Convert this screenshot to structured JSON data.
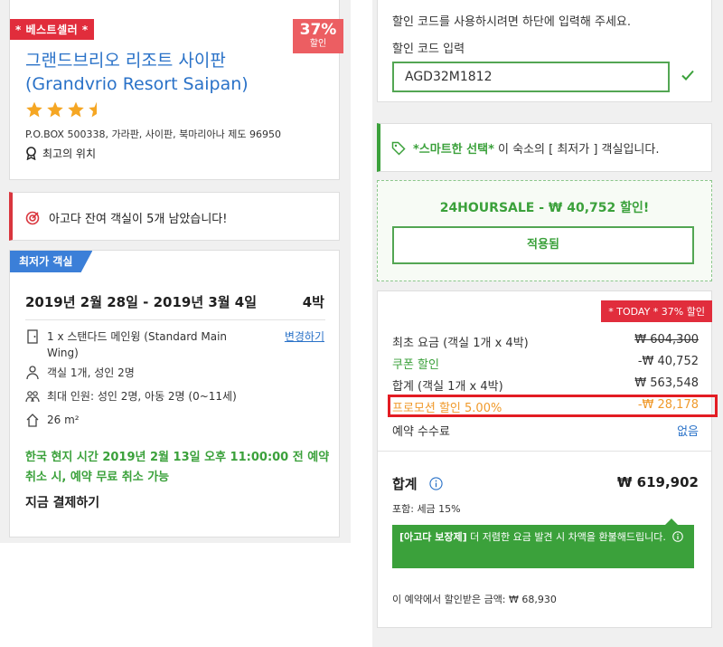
{
  "hotel": {
    "badge": "* 베스트셀러 *",
    "discount_pct": "37%",
    "discount_label": "할인",
    "name": "그랜드브리오 리조트 사이판 (Grandvrio Resort Saipan)",
    "star_rating": 3.5,
    "address": "P.O.BOX 500338, 가라판, 사이판, 북마리아나 제도 96950",
    "location_label": "최고의 위치"
  },
  "alert": {
    "text": "아고다 잔여 객실이 5개 남았습니다!"
  },
  "room": {
    "tag": "최저가 객실",
    "dates": "2019년 2월 28일 - 2019년 3월 4일",
    "nights": "4박",
    "room_type": "1 x 스탠다드 메인윙 (Standard Main Wing)",
    "change_link": "변경하기",
    "occupancy": "객실 1개, 성인 2명",
    "max_occupancy": "최대 인원: 성인 2명, 아동 2명 (0~11세)",
    "size": "26 m²",
    "cancellation": "한국 현지 시간 2019년 2월 13일 오후 11:00:00 전 예약 취소 시, 예약 무료 취소 가능",
    "payment": "지금 결제하기"
  },
  "promo": {
    "hint": "할인 코드를 사용하시려면 하단에 입력해 주세요.",
    "label": "할인 코드 입력",
    "code": "AGD32M1812"
  },
  "smart_choice": {
    "emph": "*스마트한 선택*",
    "text": " 이 숙소의 [ 최저가 ] 객실입니다."
  },
  "sale": {
    "title": "24HOURSALE - ₩ 40,752 할인!",
    "applied_label": "적용됨"
  },
  "price": {
    "today_tag": "* TODAY * 37% 할인",
    "base_label": "최초 요금 (객실 1개 x 4박)",
    "base_value": "₩ 604,300",
    "coupon_label": "쿠폰 할인",
    "coupon_value": "-₩ 40,752",
    "subtotal_label": "합계 (객실 1개 x 4박)",
    "subtotal_value": "₩ 563,548",
    "promo_label": "프로모션 할인 5.00%",
    "promo_value": "-₩ 28,178",
    "fee_label": "예약 수수료",
    "fee_value": "없음",
    "total_label": "합계",
    "total_value": "₩ 619,902",
    "tax_note": "포함: 세금 15%",
    "guarantee_bold": "[아고다 보장제]",
    "guarantee_text": " 더 저렴한 요금 발견 시 차액을 환불해드립니다.",
    "savings": "이 예약에서 할인받은 금액: ₩ 68,930"
  },
  "colors": {
    "accent_blue": "#2a72c8",
    "accent_green": "#3ba13b",
    "badge_red": "#e12d3c",
    "promo_orange": "#f09a2c",
    "star_orange": "#f5a623"
  }
}
